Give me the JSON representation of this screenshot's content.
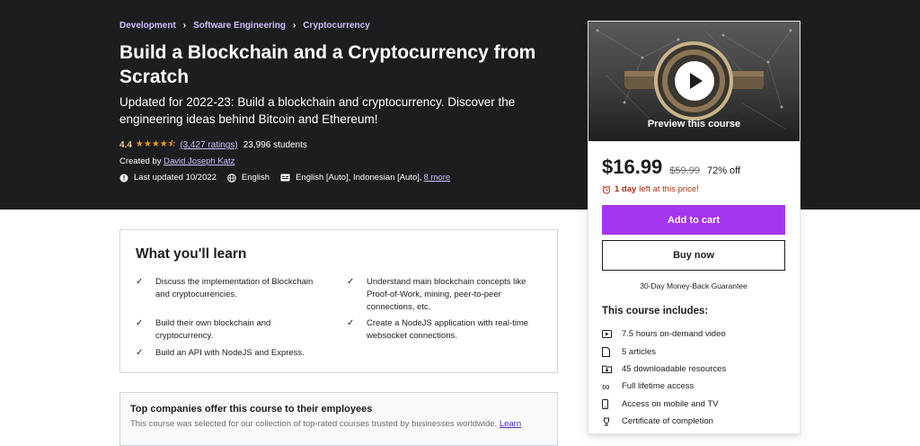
{
  "breadcrumb": [
    "Development",
    "Software Engineering",
    "Cryptocurrency"
  ],
  "course": {
    "title": "Build a Blockchain and a Cryptocurrency from Scratch",
    "subtitle": "Updated for 2022-23: Build a blockchain and cryptocurrency. Discover the engineering ideas behind Bitcoin and Ethereum!",
    "rating": "4.4",
    "rating_value": 4.4,
    "ratings_count": "(3,427 ratings)",
    "students": "23,996 students",
    "created_prefix": "Created by",
    "instructor": "David Joseph Katz",
    "last_updated": "Last updated 10/2022",
    "language": "English",
    "captions": "English [Auto], Indonesian [Auto],",
    "more_captions": "8 more"
  },
  "sidebar": {
    "preview_label": "Preview this course",
    "price": "$16.99",
    "original_price": "$59.99",
    "discount": "72% off",
    "timer_bold": "1 day",
    "timer_rest": "left at this price!",
    "add_to_cart": "Add to cart",
    "buy_now": "Buy now",
    "guarantee": "30-Day Money-Back Guarantee",
    "includes_title": "This course includes:",
    "includes": [
      {
        "icon": "video-icon",
        "label": "7.5 hours on-demand video"
      },
      {
        "icon": "file-icon",
        "label": "5 articles"
      },
      {
        "icon": "download-icon",
        "label": "45 downloadable resources"
      },
      {
        "icon": "infinity-icon",
        "label": "Full lifetime access"
      },
      {
        "icon": "mobile-icon",
        "label": "Access on mobile and TV"
      },
      {
        "icon": "trophy-icon",
        "label": "Certificate of completion"
      }
    ]
  },
  "learn": {
    "title": "What you'll learn",
    "items": [
      "Discuss the implementation of Blockchain and cryptocurrencies.",
      "Understand main blockchain concepts like Proof-of-Work, mining, peer-to-peer connections, etc.",
      "Build their own blockchain and cryptocurrency.",
      "Create a NodeJS application with real-time websocket connections.",
      "Build an API with NodeJS and Express."
    ]
  },
  "companies": {
    "title": "Top companies offer this course to their employees",
    "text": "This course was selected for our collection of top-rated courses trusted by businesses worldwide.",
    "link": "Learn"
  },
  "colors": {
    "hero_bg": "#1c1d1f",
    "accent_purple": "#a435f0",
    "link_light": "#cec0fc",
    "star": "#e59819",
    "timer_red": "#b32d0f"
  }
}
